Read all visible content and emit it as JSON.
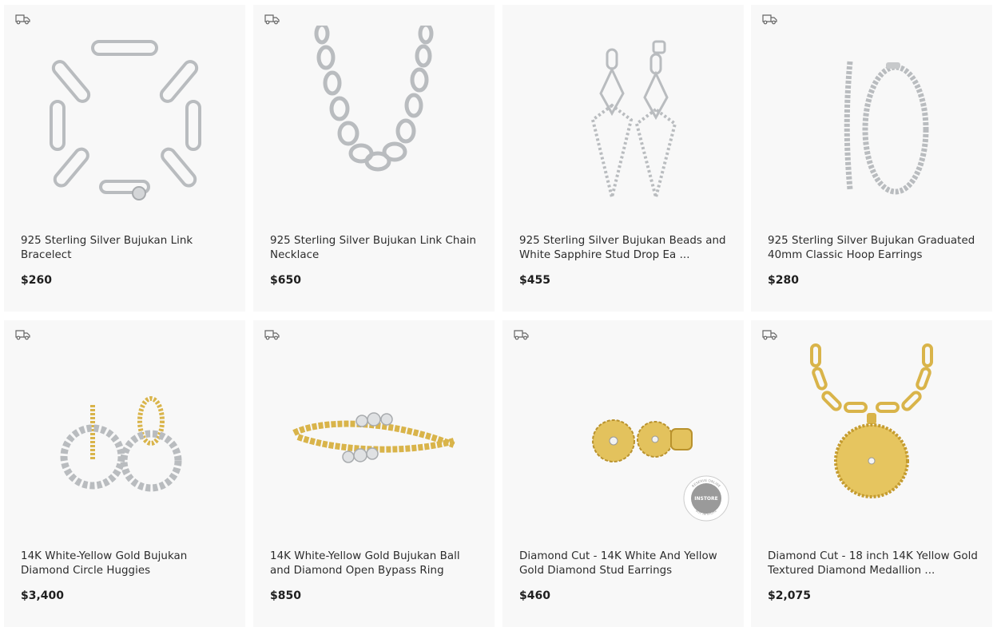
{
  "colors": {
    "card_bg": "#f8f8f8",
    "silver": "#b9bcbf",
    "gold": "#d9b44a",
    "text": "#2c2c2c"
  },
  "products": [
    {
      "title": "925 Sterling Silver Bujukan Link Bracelect",
      "price": "$260",
      "icon": "delivery-truck-icon"
    },
    {
      "title": "925 Sterling Silver Bujukan Link Chain Necklace",
      "price": "$650",
      "icon": "delivery-truck-icon"
    },
    {
      "title": "925 Sterling Silver Bujukan Beads and White Sapphire Stud Drop Ea ...",
      "price": "$455",
      "icon": "delivery-truck-icon"
    },
    {
      "title": "925 Sterling Silver Bujukan Graduated 40mm Classic Hoop Earrings",
      "price": "$280",
      "icon": "delivery-truck-icon"
    },
    {
      "title": "14K White-Yellow Gold Bujukan Diamond Circle Huggies",
      "price": "$3,400",
      "icon": "delivery-truck-icon"
    },
    {
      "title": "14K White-Yellow Gold Bujukan Ball and Diamond Open Bypass Ring",
      "price": "$850",
      "icon": "delivery-truck-icon"
    },
    {
      "title": "Diamond Cut - 14K White And Yellow Gold Diamond Stud Earrings",
      "price": "$460",
      "icon": "delivery-truck-icon",
      "badge": {
        "text": "INSTORE",
        "ring_top": "RESERVE ONLINE",
        "ring_bottom": "BUY IN STORE"
      }
    },
    {
      "title": "Diamond Cut - 18 inch 14K Yellow Gold Textured Diamond Medallion ...",
      "price": "$2,075",
      "icon": "delivery-truck-icon"
    }
  ]
}
